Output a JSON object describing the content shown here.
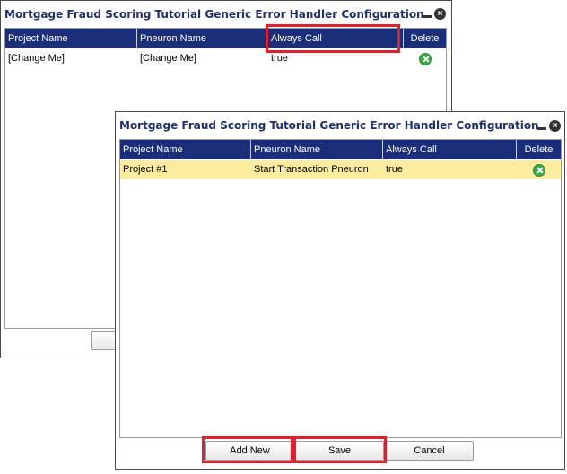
{
  "back_window": {
    "title": "Mortgage Fraud Scoring Tutorial Generic Error Handler Configuration",
    "columns": [
      "Project Name",
      "Pneuron Name",
      "Always Call",
      "Delete"
    ],
    "rows": [
      {
        "project": "[Change Me]",
        "pneuron": "[Change Me]",
        "always_call": "true"
      }
    ]
  },
  "front_window": {
    "title": "Mortgage Fraud Scoring Tutorial Generic Error Handler Configuration",
    "columns": [
      "Project Name",
      "Pneuron Name",
      "Always Call",
      "Delete"
    ],
    "rows": [
      {
        "project": "Project #1",
        "pneuron": "Start Transaction Pneuron",
        "always_call": "true"
      }
    ],
    "buttons": {
      "add_new": "Add New",
      "save": "Save",
      "cancel": "Cancel"
    }
  },
  "colors": {
    "header_bg": "#1a2e7a",
    "title_text": "#1f2f6e",
    "selected_row": "#fcec9f",
    "highlight": "#e0202c",
    "delete_icon": "#3aa94a"
  }
}
